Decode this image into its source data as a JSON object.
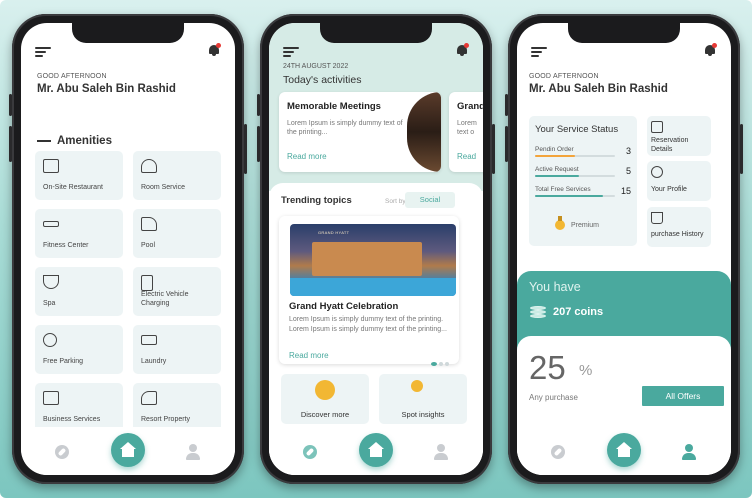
{
  "colors": {
    "accent": "#4aa99e",
    "card_bg": "#edf4f5",
    "alert": "#e53935"
  },
  "phone1": {
    "greeting": "GOOD AFTERNOON",
    "name": "Mr. Abu Saleh Bin Rashid",
    "section": "Amenities",
    "amenities": [
      {
        "label": "On-Site Restaurant",
        "icon": "restaurant-icon"
      },
      {
        "label": "Room Service",
        "icon": "room-service-icon"
      },
      {
        "label": "Fitness Center",
        "icon": "dumbbell-icon"
      },
      {
        "label": "Pool",
        "icon": "pool-icon"
      },
      {
        "label": "Spa",
        "icon": "spa-icon"
      },
      {
        "label": "Electric Vehicle Charging",
        "icon": "ev-charging-icon"
      },
      {
        "label": "Free Parking",
        "icon": "parking-icon"
      },
      {
        "label": "Laundry",
        "icon": "laundry-icon"
      },
      {
        "label": "Business Services",
        "icon": "printer-icon"
      },
      {
        "label": "Resort Property",
        "icon": "resort-icon"
      }
    ]
  },
  "phone2": {
    "date": "24TH AUGUST 2022",
    "title": "Today's activities",
    "activities": [
      {
        "title": "Memorable Meetings",
        "text": "Lorem Ipsum is simply dummy text of the printing...",
        "read_more": "Read more"
      },
      {
        "title": "Grand",
        "text": "Lorem text o",
        "read_more": "Read"
      }
    ],
    "trending_title": "Trending topics",
    "sort_by": "Sort by",
    "sort_value": "Social",
    "trend_card": {
      "title": "Grand Hyatt Celebration",
      "text": "Lorem Ipsum is simply dummy text of the printing. Lorem Ipsum is simply dummy text of the printing...",
      "read_more": "Read more",
      "image_sign": "GRAND HYATT"
    },
    "discover": "Discover more",
    "spot": "Spot insights"
  },
  "phone3": {
    "greeting": "GOOD AFTERNOON",
    "name": "Mr. Abu Saleh Bin Rashid",
    "service_title": "Your Service Status",
    "status": [
      {
        "label": "Pendin Order",
        "value": "3",
        "fraction": 0.5,
        "color": "#f3a43b"
      },
      {
        "label": "Active Request",
        "value": "5",
        "fraction": 0.55,
        "color": "#4aa99e"
      },
      {
        "label": "Total Free Services",
        "value": "15",
        "fraction": 0.85,
        "color": "#4aa99e"
      }
    ],
    "premium": "Premium",
    "side": [
      {
        "label": "Reservation Details",
        "icon": "reservation-icon"
      },
      {
        "label": "Your Profile",
        "icon": "profile-icon"
      },
      {
        "label": "purchase History",
        "icon": "cart-icon"
      }
    ],
    "you_have": "You have",
    "coins": "207 coins",
    "percent": "25",
    "percent_sym": "%",
    "any_purchase": "Any purchase",
    "all_offers": "All Offers"
  }
}
